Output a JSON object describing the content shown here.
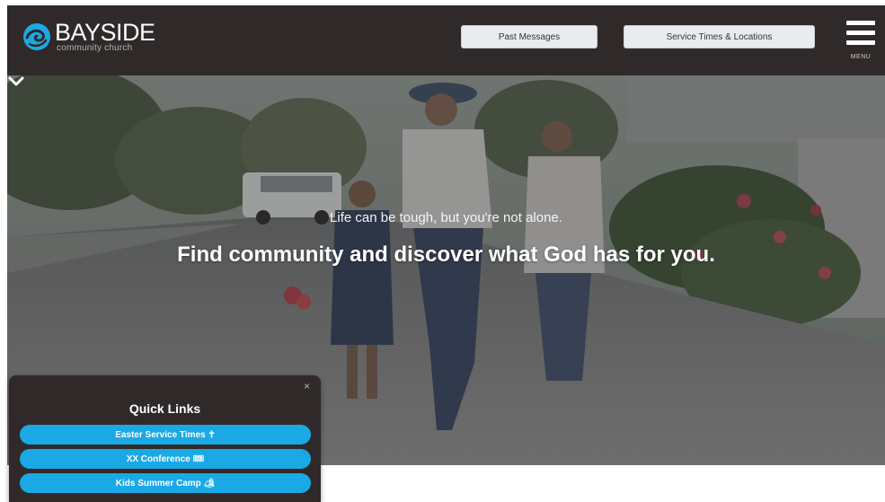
{
  "header": {
    "logo": {
      "name": "BAYSIDE",
      "sub": "community church"
    },
    "past_messages_label": "Past Messages",
    "service_times_label": "Service Times & Locations",
    "menu_label": "MENU"
  },
  "hero": {
    "tagline": "Life can be tough, but you're not alone.",
    "headline": "Find community and discover what God has for you."
  },
  "quick_links": {
    "close_glyph": "×",
    "title": "Quick Links",
    "items": [
      {
        "label": "Easter Service Times ✝"
      },
      {
        "label": "XX Conference 🎟"
      },
      {
        "label": "Kids Summer Camp 🏕"
      }
    ]
  },
  "colors": {
    "header_bg": "#2f2a29",
    "accent": "#1ba9e6",
    "button_bg": "#e8ecef"
  }
}
